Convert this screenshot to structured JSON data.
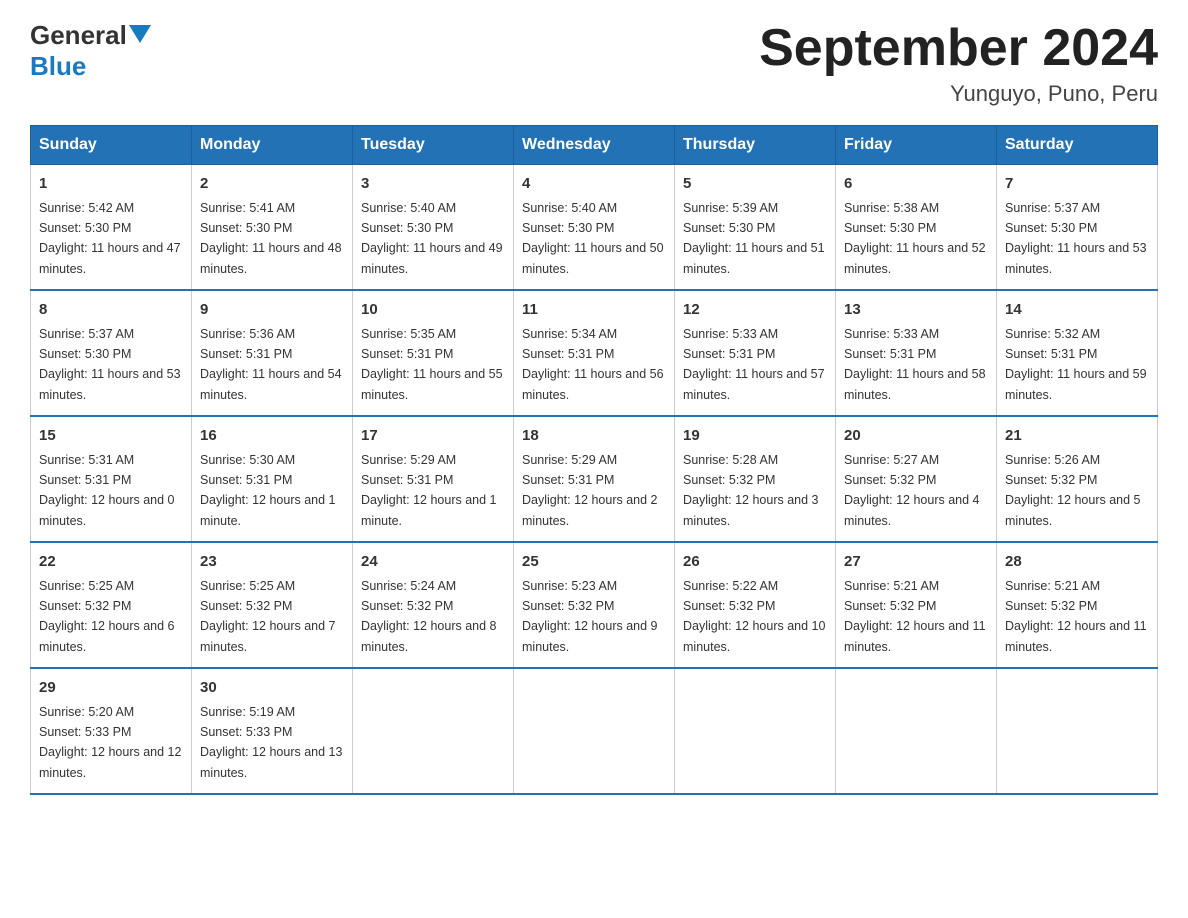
{
  "logo": {
    "text_general": "General",
    "text_blue": "Blue",
    "logo_alt": "GeneralBlue logo"
  },
  "title": "September 2024",
  "subtitle": "Yunguyo, Puno, Peru",
  "days_of_week": [
    "Sunday",
    "Monday",
    "Tuesday",
    "Wednesday",
    "Thursday",
    "Friday",
    "Saturday"
  ],
  "weeks": [
    [
      {
        "day": "1",
        "sunrise": "5:42 AM",
        "sunset": "5:30 PM",
        "daylight": "11 hours and 47 minutes."
      },
      {
        "day": "2",
        "sunrise": "5:41 AM",
        "sunset": "5:30 PM",
        "daylight": "11 hours and 48 minutes."
      },
      {
        "day": "3",
        "sunrise": "5:40 AM",
        "sunset": "5:30 PM",
        "daylight": "11 hours and 49 minutes."
      },
      {
        "day": "4",
        "sunrise": "5:40 AM",
        "sunset": "5:30 PM",
        "daylight": "11 hours and 50 minutes."
      },
      {
        "day": "5",
        "sunrise": "5:39 AM",
        "sunset": "5:30 PM",
        "daylight": "11 hours and 51 minutes."
      },
      {
        "day": "6",
        "sunrise": "5:38 AM",
        "sunset": "5:30 PM",
        "daylight": "11 hours and 52 minutes."
      },
      {
        "day": "7",
        "sunrise": "5:37 AM",
        "sunset": "5:30 PM",
        "daylight": "11 hours and 53 minutes."
      }
    ],
    [
      {
        "day": "8",
        "sunrise": "5:37 AM",
        "sunset": "5:30 PM",
        "daylight": "11 hours and 53 minutes."
      },
      {
        "day": "9",
        "sunrise": "5:36 AM",
        "sunset": "5:31 PM",
        "daylight": "11 hours and 54 minutes."
      },
      {
        "day": "10",
        "sunrise": "5:35 AM",
        "sunset": "5:31 PM",
        "daylight": "11 hours and 55 minutes."
      },
      {
        "day": "11",
        "sunrise": "5:34 AM",
        "sunset": "5:31 PM",
        "daylight": "11 hours and 56 minutes."
      },
      {
        "day": "12",
        "sunrise": "5:33 AM",
        "sunset": "5:31 PM",
        "daylight": "11 hours and 57 minutes."
      },
      {
        "day": "13",
        "sunrise": "5:33 AM",
        "sunset": "5:31 PM",
        "daylight": "11 hours and 58 minutes."
      },
      {
        "day": "14",
        "sunrise": "5:32 AM",
        "sunset": "5:31 PM",
        "daylight": "11 hours and 59 minutes."
      }
    ],
    [
      {
        "day": "15",
        "sunrise": "5:31 AM",
        "sunset": "5:31 PM",
        "daylight": "12 hours and 0 minutes."
      },
      {
        "day": "16",
        "sunrise": "5:30 AM",
        "sunset": "5:31 PM",
        "daylight": "12 hours and 1 minute."
      },
      {
        "day": "17",
        "sunrise": "5:29 AM",
        "sunset": "5:31 PM",
        "daylight": "12 hours and 1 minute."
      },
      {
        "day": "18",
        "sunrise": "5:29 AM",
        "sunset": "5:31 PM",
        "daylight": "12 hours and 2 minutes."
      },
      {
        "day": "19",
        "sunrise": "5:28 AM",
        "sunset": "5:32 PM",
        "daylight": "12 hours and 3 minutes."
      },
      {
        "day": "20",
        "sunrise": "5:27 AM",
        "sunset": "5:32 PM",
        "daylight": "12 hours and 4 minutes."
      },
      {
        "day": "21",
        "sunrise": "5:26 AM",
        "sunset": "5:32 PM",
        "daylight": "12 hours and 5 minutes."
      }
    ],
    [
      {
        "day": "22",
        "sunrise": "5:25 AM",
        "sunset": "5:32 PM",
        "daylight": "12 hours and 6 minutes."
      },
      {
        "day": "23",
        "sunrise": "5:25 AM",
        "sunset": "5:32 PM",
        "daylight": "12 hours and 7 minutes."
      },
      {
        "day": "24",
        "sunrise": "5:24 AM",
        "sunset": "5:32 PM",
        "daylight": "12 hours and 8 minutes."
      },
      {
        "day": "25",
        "sunrise": "5:23 AM",
        "sunset": "5:32 PM",
        "daylight": "12 hours and 9 minutes."
      },
      {
        "day": "26",
        "sunrise": "5:22 AM",
        "sunset": "5:32 PM",
        "daylight": "12 hours and 10 minutes."
      },
      {
        "day": "27",
        "sunrise": "5:21 AM",
        "sunset": "5:32 PM",
        "daylight": "12 hours and 11 minutes."
      },
      {
        "day": "28",
        "sunrise": "5:21 AM",
        "sunset": "5:32 PM",
        "daylight": "12 hours and 11 minutes."
      }
    ],
    [
      {
        "day": "29",
        "sunrise": "5:20 AM",
        "sunset": "5:33 PM",
        "daylight": "12 hours and 12 minutes."
      },
      {
        "day": "30",
        "sunrise": "5:19 AM",
        "sunset": "5:33 PM",
        "daylight": "12 hours and 13 minutes."
      },
      null,
      null,
      null,
      null,
      null
    ]
  ],
  "labels": {
    "sunrise": "Sunrise:",
    "sunset": "Sunset:",
    "daylight": "Daylight:"
  }
}
